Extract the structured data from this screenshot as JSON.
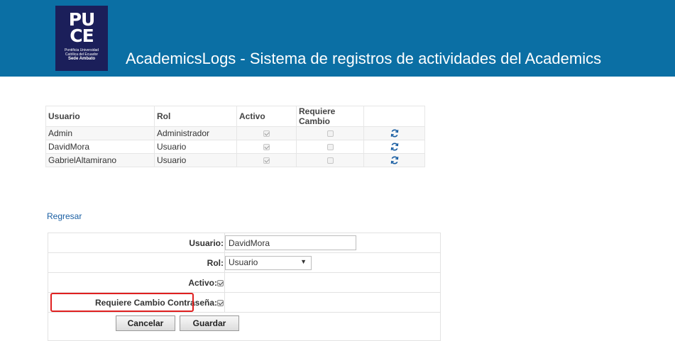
{
  "header": {
    "logo_line1": "PU",
    "logo_line2": "CE",
    "logo_small": "Pontificia Universidad Católica del Ecuador",
    "logo_sub": "Sede Ambato",
    "title": "AcademicsLogs - Sistema de registros de actividades del Academics",
    "bg_color": "#0b6fa4"
  },
  "users_table": {
    "headers": [
      "Usuario",
      "Rol",
      "Activo",
      "Requiere Cambio",
      ""
    ],
    "rows": [
      {
        "usuario": "Admin",
        "rol": "Administrador",
        "activo": true,
        "requiere_cambio": false,
        "action_icon": "refresh-icon"
      },
      {
        "usuario": "DavidMora",
        "rol": "Usuario",
        "activo": true,
        "requiere_cambio": false,
        "action_icon": "refresh-icon"
      },
      {
        "usuario": "GabrielAltamirano",
        "rol": "Usuario",
        "activo": true,
        "requiere_cambio": false,
        "action_icon": "refresh-icon"
      }
    ]
  },
  "back_link": "Regresar",
  "form": {
    "usuario_label": "Usuario:",
    "usuario_value": "DavidMora",
    "rol_label": "Rol:",
    "rol_value": "Usuario",
    "activo_label": "Activo:",
    "activo_checked": true,
    "requiere_label": "Requiere Cambio Contraseña:",
    "requiere_checked": true,
    "cancel_label": "Cancelar",
    "save_label": "Guardar"
  },
  "colors": {
    "link": "#1a5fa3",
    "highlight": "#e02020",
    "icon": "#1a5fa3"
  }
}
